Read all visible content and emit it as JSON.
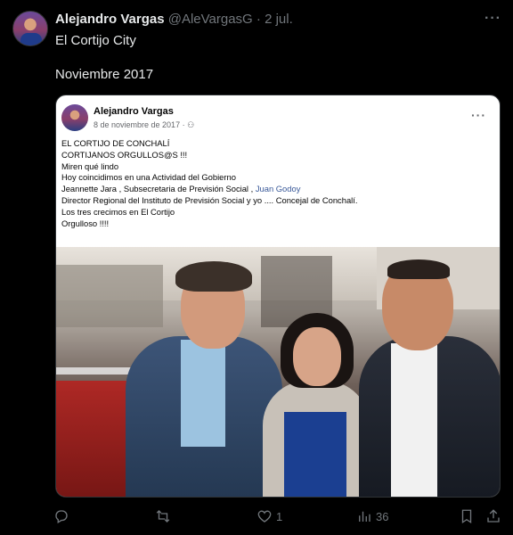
{
  "tweet": {
    "name": "Alejandro Vargas",
    "handle": "@AleVargasG",
    "separator": "·",
    "date": "2 jul.",
    "more": "···",
    "line1": "El Cortijo City",
    "line2": "Noviembre 2017"
  },
  "embed": {
    "name": "Alejandro Vargas",
    "meta": "8 de noviembre de 2017 · ⚇",
    "more": "···",
    "lines": [
      "EL CORTIJO DE CONCHALÍ",
      "CORTIJANOS ORGULLOS@S !!!",
      "Miren qué lindo",
      "Hoy coincidimos en una Actividad del Gobierno"
    ],
    "line_mention_prefix": "Jeannette Jara , Subsecretaria de Previsión Social , ",
    "line_mention": "Juan Godoy",
    "lines_after": [
      "Director Regional del Instituto de Previsión Social y yo .... Concejal de Conchalí.",
      "Los tres crecimos en El Cortijo",
      "Orgulloso !!!!"
    ]
  },
  "actions": {
    "reply_count": "",
    "retweet_count": "",
    "like_count": "1",
    "views_count": "36"
  }
}
